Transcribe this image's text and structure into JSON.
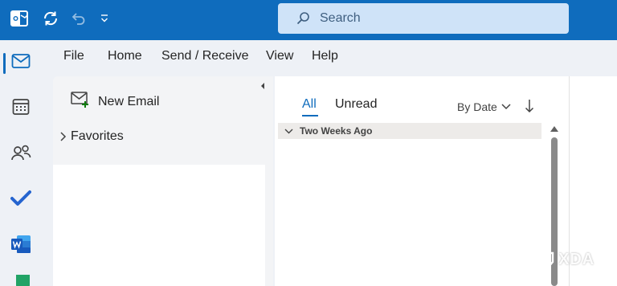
{
  "titlebar": {
    "search": {
      "placeholder": "Search"
    },
    "icons": [
      "outlook-logo-icon",
      "sync-icon",
      "undo-icon",
      "quick-access-chevron-icon"
    ]
  },
  "menubar": {
    "items": [
      {
        "label": "File"
      },
      {
        "label": "Home"
      },
      {
        "label": "Send / Receive"
      },
      {
        "label": "View"
      },
      {
        "label": "Help"
      }
    ]
  },
  "nav_rail": {
    "items": [
      "mail-icon",
      "calendar-icon",
      "people-icon",
      "todo-icon",
      "word-icon"
    ],
    "active": "mail-icon"
  },
  "folder_pane": {
    "new_email_label": "New Email",
    "favorites_label": "Favorites"
  },
  "mail_list": {
    "tabs": [
      {
        "label": "All",
        "active": true
      },
      {
        "label": "Unread",
        "active": false
      }
    ],
    "sort_label": "By Date",
    "group_header": "Two Weeks Ago"
  },
  "watermark": {
    "text": "XDA"
  },
  "colors": {
    "brand_blue": "#0f6cbd",
    "search_bg": "#cfe3f8",
    "app_bg": "#eef1f6"
  }
}
